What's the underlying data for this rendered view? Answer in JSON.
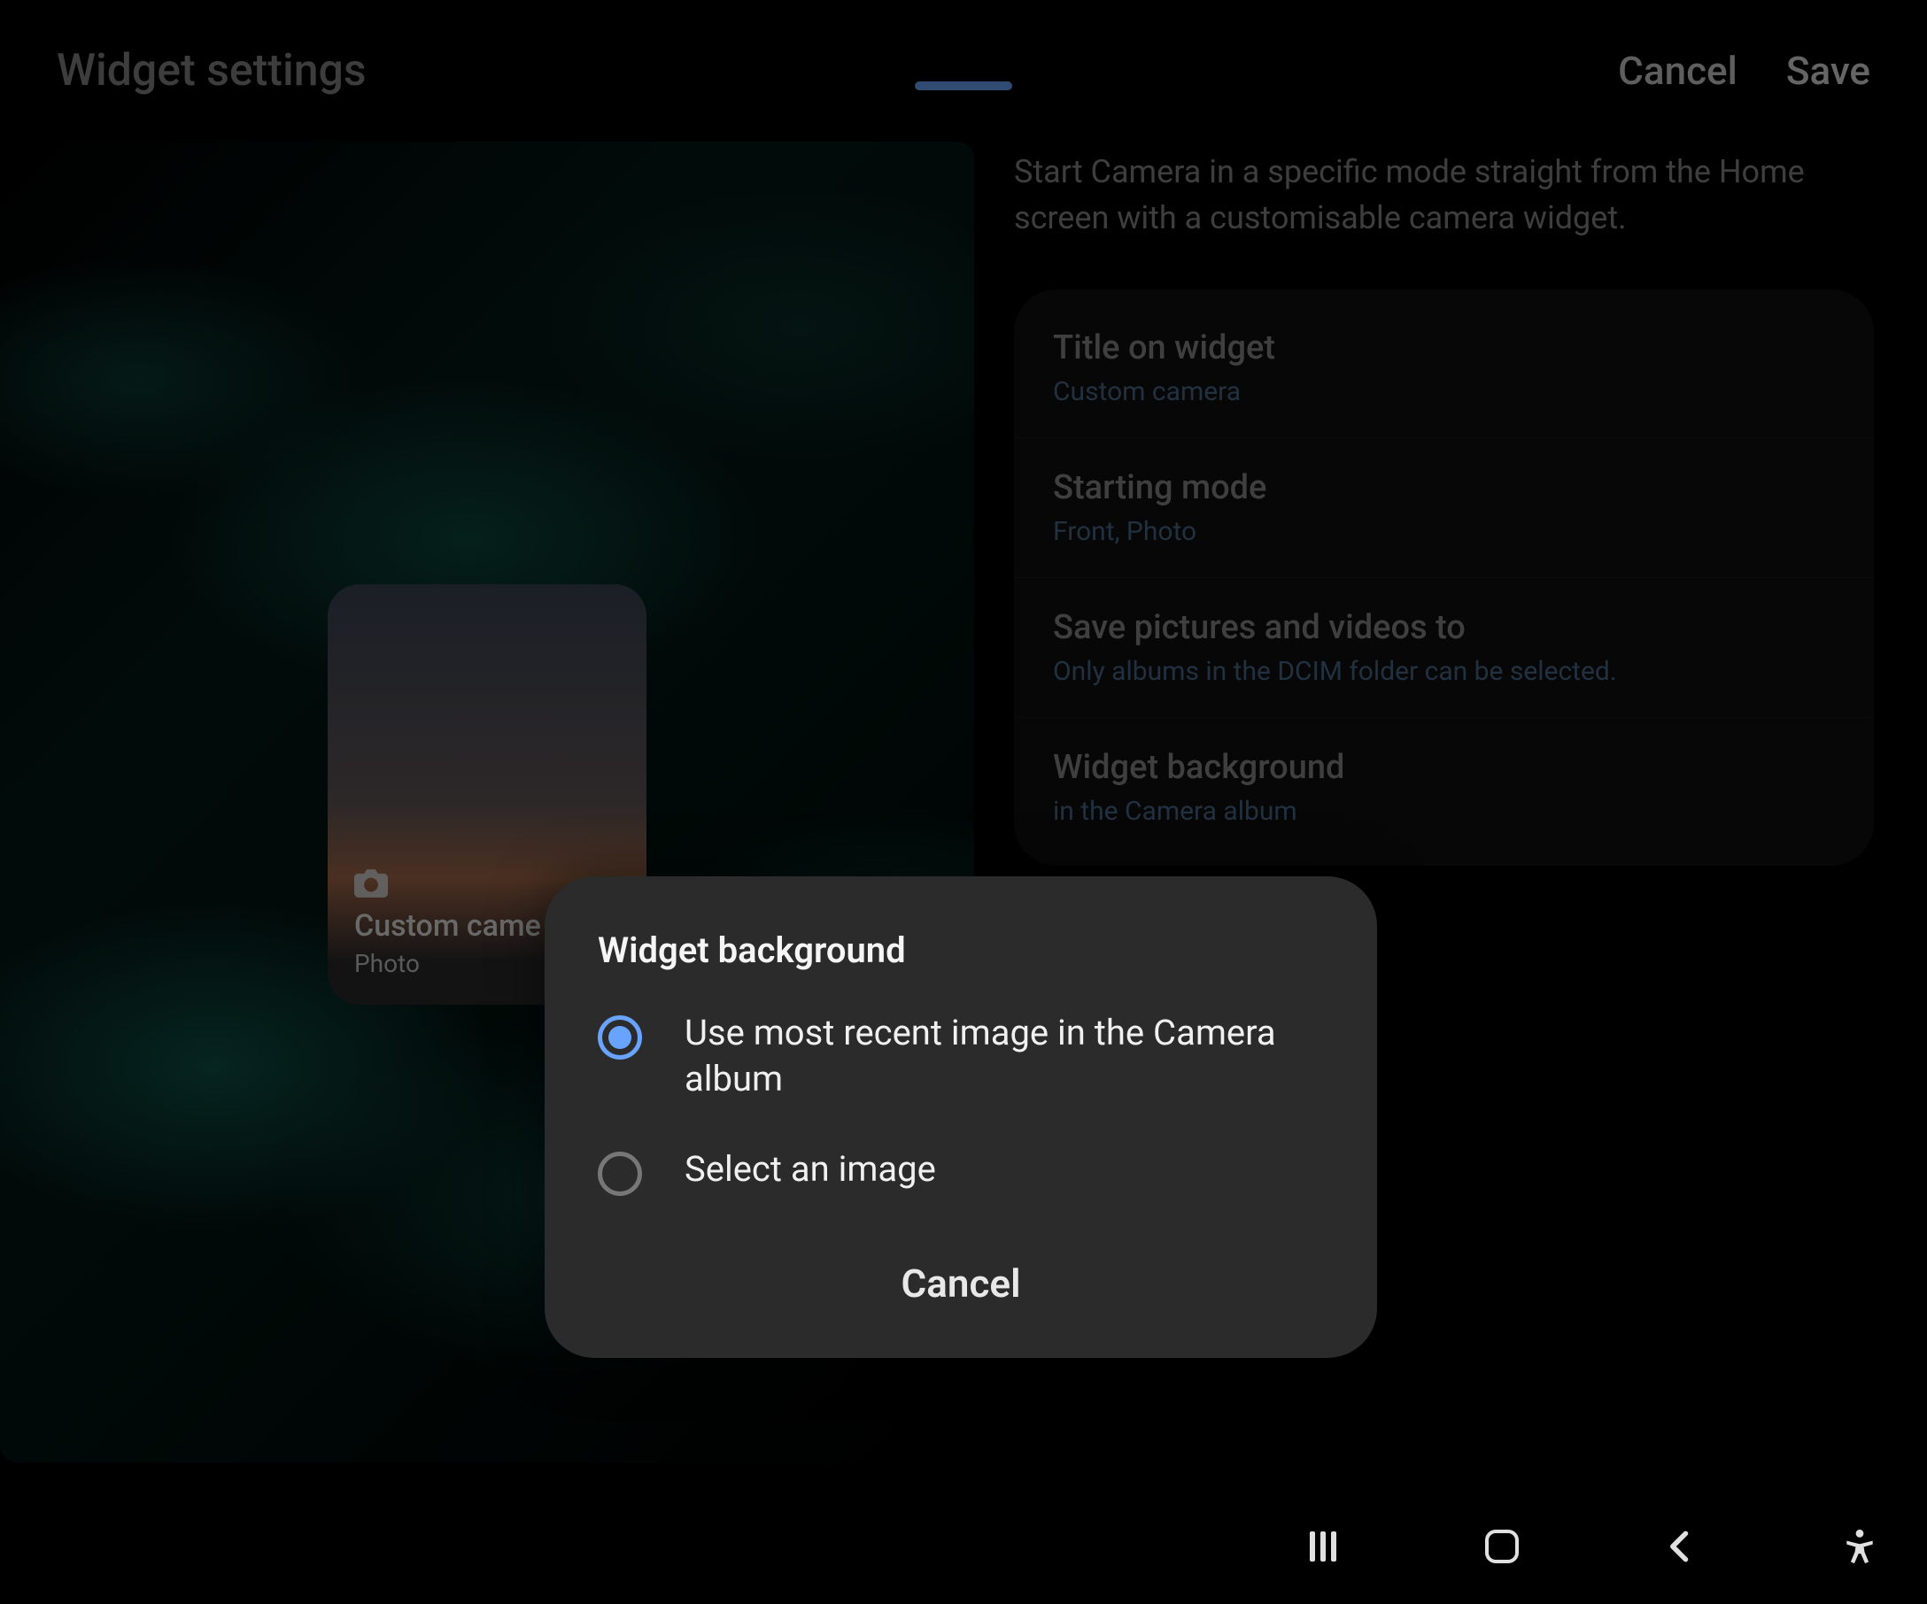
{
  "header": {
    "title": "Widget settings",
    "cancel": "Cancel",
    "save": "Save"
  },
  "preview": {
    "widgetName": "Custom came",
    "widgetMode": "Photo"
  },
  "description": "Start Camera in a specific mode straight from the Home screen with a customisable camera widget.",
  "settings": [
    {
      "title": "Title on widget",
      "value": "Custom camera"
    },
    {
      "title": "Starting mode",
      "value": "Front, Photo"
    },
    {
      "title": "Save pictures and videos to",
      "value": "Only albums in the DCIM folder can be selected."
    },
    {
      "title": "Widget background",
      "value": "in the Camera album"
    }
  ],
  "dialog": {
    "title": "Widget background",
    "options": [
      "Use most recent image in the Camera album",
      "Select an image"
    ],
    "cancel": "Cancel"
  }
}
